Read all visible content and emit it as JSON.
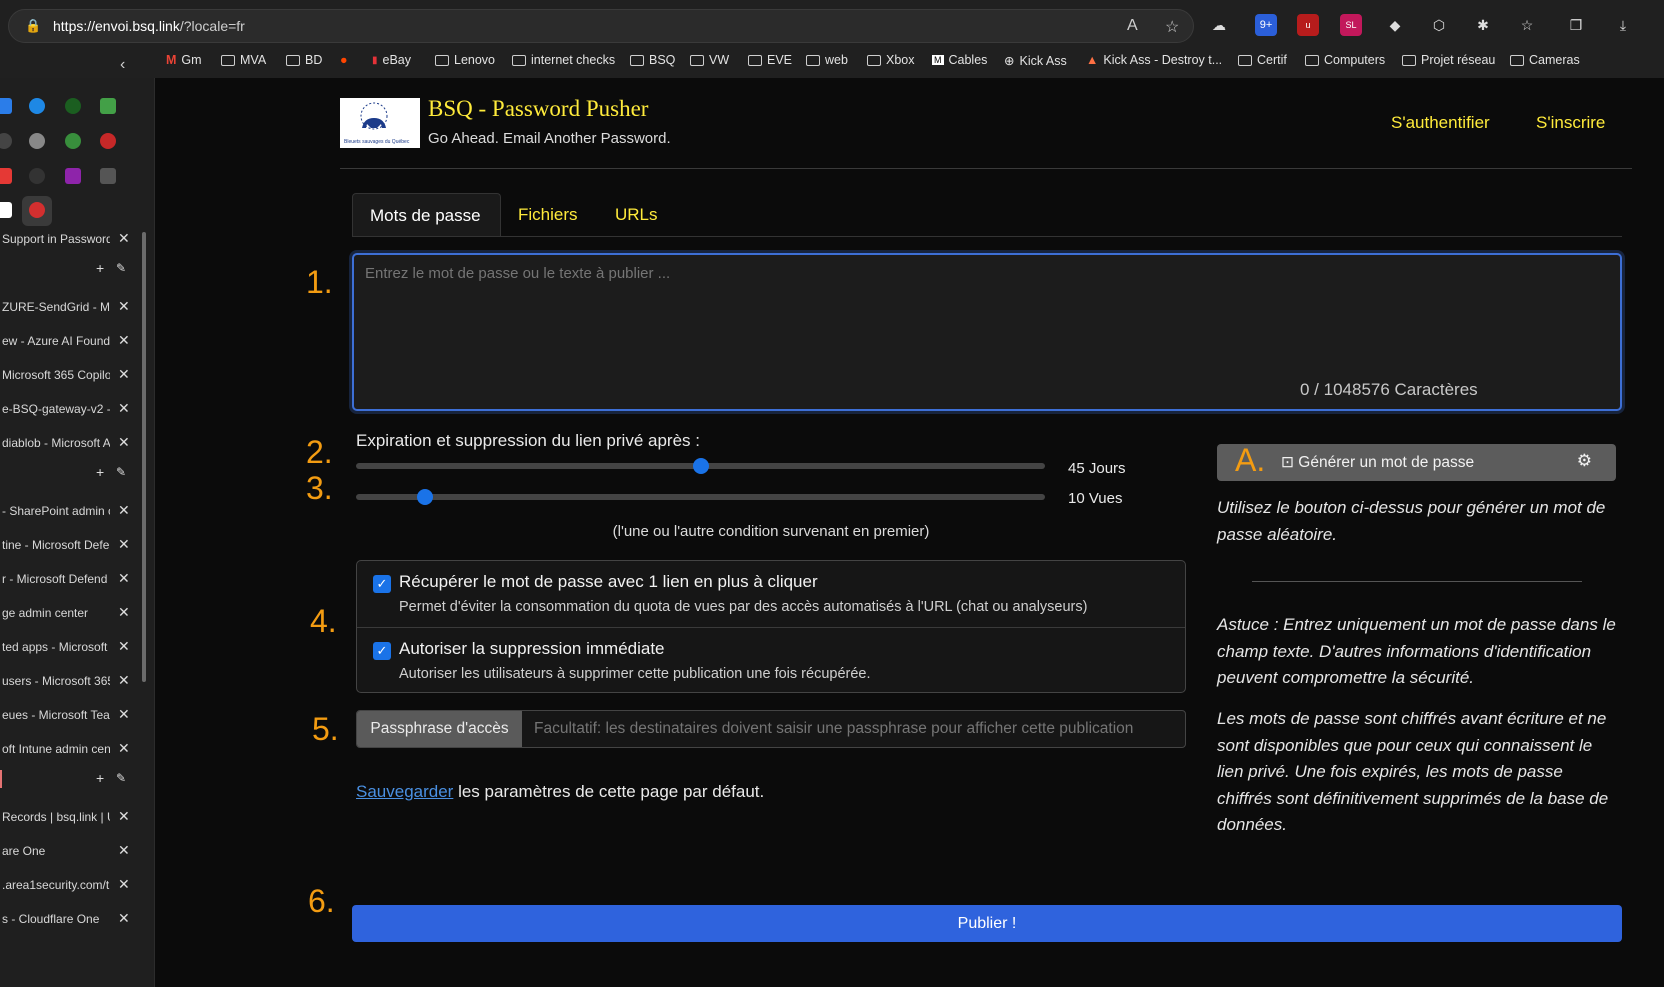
{
  "browser": {
    "url_host": "https://envoi.bsq.link",
    "url_path": "/?locale=fr",
    "bookmarks": [
      "Gm",
      "MVA",
      "BD",
      "eBay",
      "Lenovo",
      "internet checks",
      "BSQ",
      "VW",
      "EVE",
      "web",
      "Xbox",
      "Cables",
      "Kick Ass",
      "Kick Ass - Destroy t...",
      "Certif",
      "Computers",
      "Projet réseau",
      "Cameras"
    ]
  },
  "sidebar": {
    "tabs": [
      "Support in Password",
      "ZURE-SendGrid - Mic",
      "ew - Azure AI Foundr",
      "Microsoft 365 Copilo",
      "e-BSQ-gateway-v2 -",
      "diablob - Microsoft A",
      "- SharePoint admin c",
      "tine - Microsoft Defe",
      "r - Microsoft Defend",
      "ge admin center",
      "ted apps - Microsoft",
      "users - Microsoft 365",
      "eues - Microsoft Tear",
      "oft Intune admin cent",
      "Records | bsq.link | U",
      "are One",
      ".area1security.com/t",
      "s - Cloudflare One"
    ]
  },
  "header": {
    "brand": "BSQ - Password Pusher",
    "tagline": "Go Ahead. Email Another Password.",
    "logo_text": "Bleuets sauvages du Québec",
    "login": "S'authentifier",
    "signup": "S'inscrire"
  },
  "tabs": [
    "Mots de passe",
    "Fichiers",
    "URLs"
  ],
  "steps": {
    "one": "1.",
    "two": "2.",
    "three": "3.",
    "four": "4.",
    "five": "5.",
    "six": "6.",
    "a": "A."
  },
  "form": {
    "textarea_placeholder": "Entrez le mot de passe ou le texte à publier ...",
    "char_count": "0 / 1048576 Caractères",
    "expiration_label": "Expiration et suppression du lien privé après :",
    "days_value": "45 Jours",
    "days_fraction": 0.5,
    "views_value": "10 Vues",
    "views_fraction": 0.1,
    "condition_note": "(l'une ou l'autre condition survenant en premier)",
    "check1_title": "Récupérer le mot de passe avec 1 lien en plus à cliquer",
    "check1_sub": "Permet d'éviter la consommation du quota de vues par des accès automatisés à l'URL (chat ou analyseurs)",
    "check2_title": "Autoriser la suppression immédiate",
    "check2_sub": "Autoriser les utilisateurs à supprimer cette publication une fois récupérée.",
    "passphrase_addon": "Passphrase d'accès",
    "passphrase_placeholder": "Facultatif: les destinataires doivent saisir une passphrase pour afficher cette publication",
    "save_link": "Sauvegarder",
    "save_rest": " les paramètres de cette page par défaut.",
    "publish": "Publier !"
  },
  "aside": {
    "generate": "Générer un mot de passe",
    "generate_hint": "Utilisez le bouton ci-dessus pour générer un mot de passe aléatoire.",
    "tip": "Astuce : Entrez uniquement un mot de passe dans le champ texte. D'autres informations d'identification peuvent compromettre la sécurité.",
    "info": "Les mots de passe sont chiffrés avant écriture et ne sont disponibles que pour ceux qui connaissent le lien privé. Une fois expirés, les mots de passe chiffrés sont définitivement supprimés de la base de données."
  },
  "colors": {
    "accent": "#ffeb3b",
    "step": "#f39c12",
    "primary": "#2f63dd"
  }
}
